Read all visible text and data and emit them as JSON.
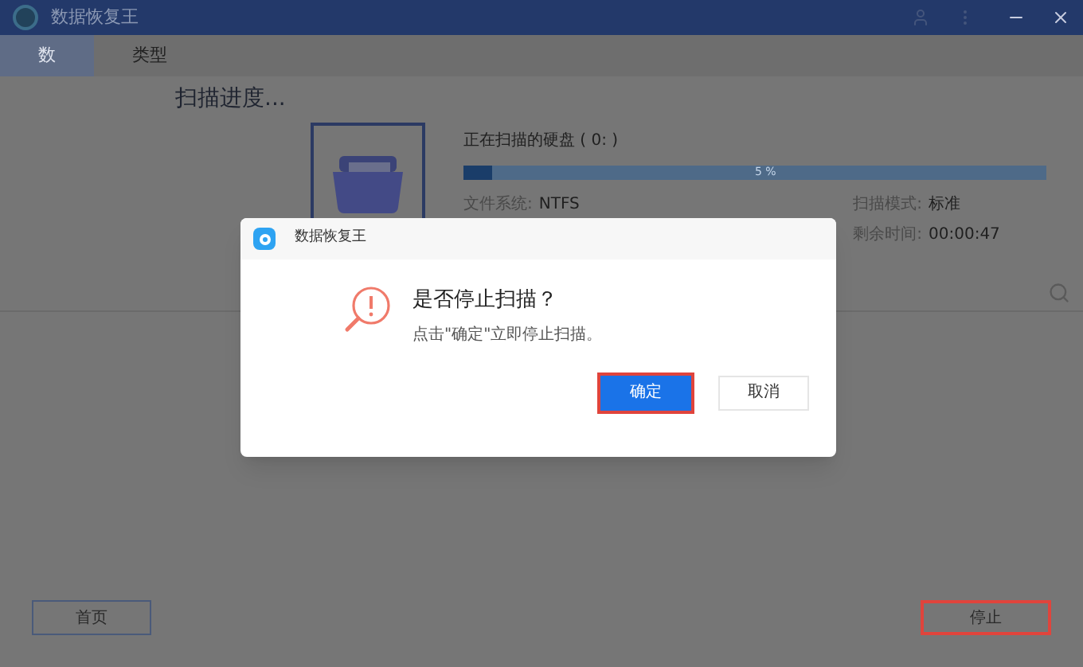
{
  "window": {
    "title": "数据恢复王"
  },
  "tabs": [
    {
      "label": "数",
      "selected": true
    },
    {
      "label": "类型",
      "selected": false
    }
  ],
  "scan": {
    "heading": "扫描进度...",
    "disk": "正在扫描的硬盘 ( 0: )",
    "level": 0.05,
    "percent": "5 %",
    "filesystem_label": "文件系统:",
    "filesystem": "NTFS",
    "mode_label": "扫描模式:",
    "mode": "标准",
    "time_label": "剩余时间:",
    "time": "00:00:47"
  },
  "dialog": {
    "title": "数据恢复王",
    "question": "是否停止扫描？",
    "message": "点击\"确定\"立即停止扫描。",
    "buttons": [
      {
        "label": "确定",
        "kind": "primary",
        "highlighted": true
      },
      {
        "label": "取消",
        "kind": "secondary",
        "highlighted": false
      }
    ]
  },
  "footer": [
    {
      "label": "首页",
      "kind": "back",
      "highlighted": false
    },
    {
      "label": "停止",
      "kind": "stop",
      "highlighted": true
    }
  ]
}
